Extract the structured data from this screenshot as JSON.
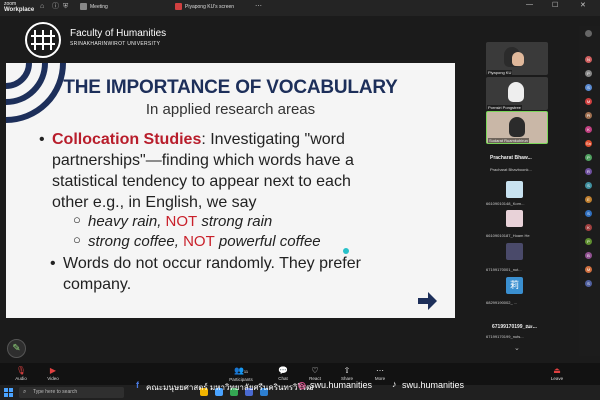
{
  "app": {
    "brand_top": "zoom",
    "brand_bottom": "Workplace"
  },
  "tabs": [
    {
      "label": "Meeting"
    },
    {
      "label": "Piyapong KU's screen"
    }
  ],
  "header": {
    "faculty": "Faculty of Humanities",
    "university": "SRINAKHARINWIROT UNIVERSITY"
  },
  "slide": {
    "title": "THE IMPORTANCE OF VOCABULARY",
    "subtitle": "In applied research areas",
    "b1_term": "Collocation Studies",
    "b1_line1": ": Investigating \"word",
    "b1_line2": "partnerships\"—finding which words have a",
    "b1_line3": "statistical tendency to appear next to each",
    "b1_line4": "other e.g., in English, we say",
    "ex1_a": "heavy rain, ",
    "ex1_not": "NOT",
    "ex1_b": " strong rain",
    "ex2_a": "strong coffee, ",
    "ex2_not": "NOT",
    "ex2_b": " powerful coffee",
    "b2_line1": "Words do not occur randomly.  They prefer",
    "b2_line2": "company."
  },
  "participants": {
    "tiles": [
      {
        "name": "Piyapong KU"
      },
      {
        "name": "Pornsiri Pongstree"
      },
      {
        "name": "Sudarat Ruamkuhirun"
      }
    ],
    "name_big": "Pracharat  Bhaw...",
    "name_small": "Pracharat Bhavboonk...",
    "list": [
      "66109010148_Korn...",
      "66109010187_Hoam He",
      "67199170001_nut...",
      "68299190002_ ...",
      "67199170199_เอ...",
      "67199170199_nuts..."
    ],
    "tiles2": [
      "67199170199_ณะ..."
    ]
  },
  "toolbar": {
    "audio": "Audio",
    "video": "Video",
    "participants": "Participants",
    "participants_count": "11",
    "chat": "Chat",
    "react": "React",
    "share": "Share",
    "more": "More",
    "leave": "Leave"
  },
  "banner": {
    "text": "คณะมนุษยศาสตร์ มหาวิทยาลัยศรีนครินทรวิโรฒ",
    "ig": "swu.humanities",
    "tiktok": "swu.humanities"
  },
  "taskbar": {
    "search_placeholder": "Type here to search"
  },
  "rail": {
    "badges": [
      "N",
      "P",
      "S",
      "M",
      "Pl",
      "K",
      "Sn",
      "P",
      "R",
      "S",
      "E",
      "S",
      "K",
      "P",
      "B",
      "M",
      "S"
    ]
  }
}
